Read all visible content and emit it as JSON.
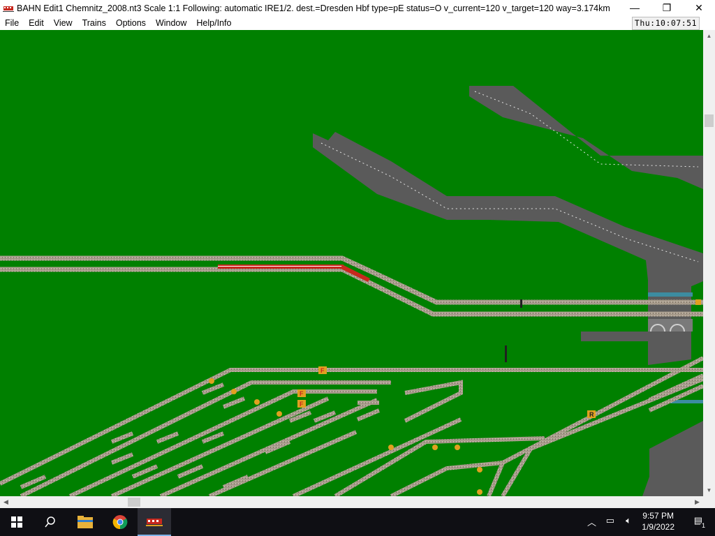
{
  "window": {
    "title": "BAHN Edit1 Chemnitz_2008.nt3 Scale 1:1 Following: automatic IRE1/2.  dest.=Dresden Hbf type=pE status=O  v_current=120 v_target=120 way=3.174km",
    "minimize": "—",
    "maximize": "❐",
    "close": "✕"
  },
  "menu": {
    "items": [
      "File",
      "Edit",
      "View",
      "Trains",
      "Options",
      "Window",
      "Help/Info"
    ]
  },
  "clock": "Thu:10:07:51",
  "map": {
    "signal_labels": [
      "F",
      "F",
      "F",
      "R"
    ],
    "colors": {
      "grass": "#008000",
      "road": "#5a5a5a",
      "track_ballast": "#a89c8c",
      "train_red": "#c8281e"
    }
  },
  "taskbar": {
    "time": "9:57 PM",
    "date": "1/9/2022",
    "notification_count": "1",
    "icons": [
      "windows-start-icon",
      "search-icon",
      "file-explorer-icon",
      "chrome-icon",
      "bahn-app-icon"
    ]
  }
}
